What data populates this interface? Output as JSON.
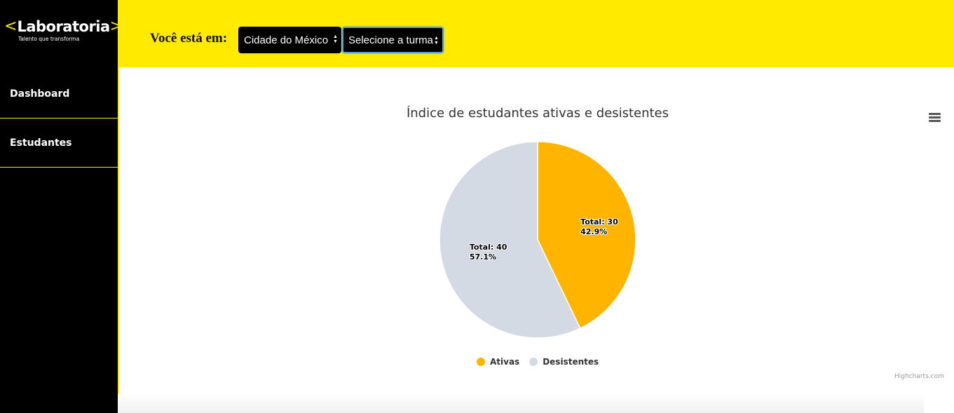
{
  "brand": {
    "name": "Laboratoria",
    "bracket_left": "<",
    "bracket_right": ">",
    "tagline": "Talento que transforma",
    "accent_color": "#ffe600"
  },
  "sidebar": {
    "items": [
      {
        "label": "Dashboard"
      },
      {
        "label": "Estudantes"
      }
    ]
  },
  "header": {
    "location_label": "Você está em:",
    "city_select": {
      "value": "Cidade do México"
    },
    "class_select": {
      "value": "Selecione a turma"
    }
  },
  "chart": {
    "credits": "Highcharts.com",
    "menu_icon": "hamburger-icon"
  },
  "chart_data": {
    "type": "pie",
    "title": "Índice de estudantes ativas e desistentes",
    "series": [
      {
        "name": "Ativas",
        "value": 30,
        "percent": "42.9%",
        "label_line1": "Total: 30",
        "label_line2": "42.9%",
        "color": "#ffb400"
      },
      {
        "name": "Desistentes",
        "value": 40,
        "percent": "57.1%",
        "label_line1": "Total: 40",
        "label_line2": "57.1%",
        "color": "#d3dae3"
      }
    ],
    "legend_position": "bottom-center"
  }
}
